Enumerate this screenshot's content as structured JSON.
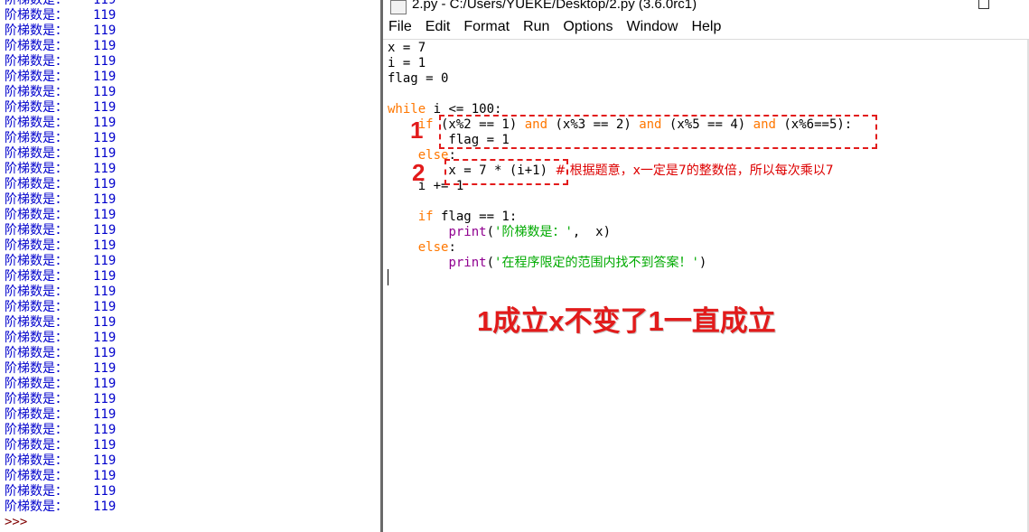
{
  "shell": {
    "label": "阶梯数是：",
    "value": "119",
    "line_count": 34,
    "prompt": ">>>"
  },
  "editor": {
    "title": "2.py - C:/Users/YUEKE/Desktop/2.py (3.6.0rc1)",
    "menu": [
      "File",
      "Edit",
      "Format",
      "Run",
      "Options",
      "Window",
      "Help"
    ],
    "code": {
      "l1": "x = 7",
      "l2": "i = 1",
      "l3": "flag = 0",
      "l5_kw": "while",
      "l5_rest": " i <= 100:",
      "l6_indent": "    ",
      "l6_kw": "if",
      "l6_a": " (x%2 == 1) ",
      "l6_and1": "and",
      "l6_b": " (x%3 == 2) ",
      "l6_and2": "and",
      "l6_c": " (x%5 == 4) ",
      "l6_and3": "and",
      "l6_d": " (x%6==5):",
      "l7": "        flag = 1",
      "l8_indent": "    ",
      "l8_kw": "else",
      "l8_rest": ":",
      "l9_code": "        x = 7 * (i+1) ",
      "l9_comment": "# 根据题意，x一定是7的整数倍，所以每次乘以7",
      "l10": "    i += 1",
      "l12_indent": "    ",
      "l12_kw": "if",
      "l12_rest": " flag == 1:",
      "l13_indent": "        ",
      "l13_bi": "print",
      "l13_p1": "(",
      "l13_str": "'阶梯数是：'",
      "l13_rest": ",  x)",
      "l14_indent": "    ",
      "l14_kw": "else",
      "l14_rest": ":",
      "l15_indent": "        ",
      "l15_bi": "print",
      "l15_p1": "(",
      "l15_str": "'在程序限定的范围内找不到答案！'",
      "l15_rest": ")"
    }
  },
  "annotations": {
    "num1": "1",
    "num2": "2",
    "note": "1成立x不变了1一直成立"
  },
  "colors": {
    "keyword": "#ff7700",
    "builtin": "#900090",
    "string": "#00aa00",
    "comment": "#dd0000",
    "shell_output": "#0000cc",
    "annotation": "#e21b1b"
  }
}
